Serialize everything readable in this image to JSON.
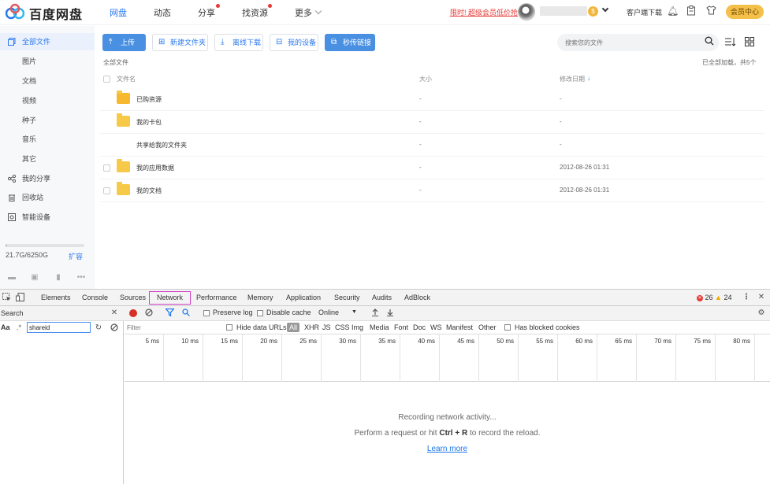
{
  "header": {
    "logo_text": "百度网盘",
    "nav": [
      {
        "label": "网盘",
        "active": true
      },
      {
        "label": "动态",
        "active": false
      },
      {
        "label": "分享",
        "active": false,
        "dot": true
      },
      {
        "label": "找资源",
        "active": false,
        "dot": true
      },
      {
        "label": "更多",
        "active": false
      }
    ],
    "promo": "限时! 超级会员低价抢",
    "vip_badge": "$",
    "client_download": "客户端下载",
    "member_center": "会员中心"
  },
  "sidebar": {
    "items": [
      {
        "label": "全部文件",
        "icon": "files-icon",
        "active": true
      },
      {
        "label": "图片",
        "sub": true
      },
      {
        "label": "文档",
        "sub": true
      },
      {
        "label": "视频",
        "sub": true
      },
      {
        "label": "种子",
        "sub": true
      },
      {
        "label": "音乐",
        "sub": true
      },
      {
        "label": "其它",
        "sub": true
      },
      {
        "label": "我的分享",
        "icon": "share-icon"
      },
      {
        "label": "回收站",
        "icon": "trash-icon"
      },
      {
        "label": "智能设备",
        "icon": "device-icon"
      }
    ],
    "quota_text": "21.7G/6250G",
    "quota_fraction": 0.0035,
    "expand_label": "扩容"
  },
  "toolbar": {
    "upload": "上传",
    "new_folder": "新建文件夹",
    "offline_download": "离线下载",
    "my_devices": "我的设备",
    "instant_link": "秒传链接",
    "search_placeholder": "搜索您的文件"
  },
  "content": {
    "breadcrumb": "全部文件",
    "loaded_note": "已全部加载，共5个",
    "columns": {
      "name": "文件名",
      "size": "大小",
      "date": "修改日期"
    },
    "files": [
      {
        "name": "已购资源",
        "size": "-",
        "date": "-",
        "has_checkbox": false
      },
      {
        "name": "我的卡包",
        "size": "-",
        "date": "-",
        "has_checkbox": false
      },
      {
        "name": "共享给我的文件夹",
        "size": "-",
        "date": "-",
        "has_checkbox": false
      },
      {
        "name": "我的应用数据",
        "size": "-",
        "date": "2012-08-26 01:31",
        "has_checkbox": true
      },
      {
        "name": "我的文档",
        "size": "-",
        "date": "2012-08-26 01:31",
        "has_checkbox": true
      }
    ]
  },
  "devtools": {
    "tabs": [
      "Elements",
      "Console",
      "Sources",
      "Network",
      "Performance",
      "Memory",
      "Application",
      "Security",
      "Audits",
      "AdBlock"
    ],
    "active_tab": "Network",
    "error_count": "26",
    "warning_count": "24",
    "search_label": "Search",
    "search_case_label": "Aa",
    "search_value": "shareid",
    "preserve_log": "Preserve log",
    "disable_cache": "Disable cache",
    "throttle": "Online",
    "filter_placeholder": "Filter",
    "hide_data_urls": "Hide data URLs",
    "filter_types": [
      "All",
      "XHR",
      "JS",
      "CSS",
      "Img",
      "Media",
      "Font",
      "Doc",
      "WS",
      "Manifest",
      "Other"
    ],
    "has_blocked_cookies": "Has blocked cookies",
    "timeline_ticks": [
      "5 ms",
      "10 ms",
      "15 ms",
      "20 ms",
      "25 ms",
      "30 ms",
      "35 ms",
      "40 ms",
      "45 ms",
      "50 ms",
      "55 ms",
      "60 ms",
      "65 ms",
      "70 ms",
      "75 ms",
      "80 ms"
    ],
    "empty_line1": "Recording network activity...",
    "empty_line2_pre": "Perform a request or hit",
    "empty_line2_key": "Ctrl + R",
    "empty_line2_post": "to record the reload.",
    "learn_more": "Learn more"
  }
}
